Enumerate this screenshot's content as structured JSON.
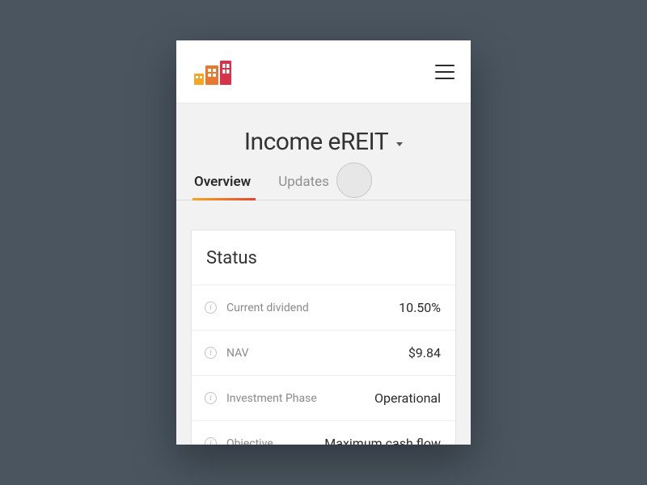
{
  "page_title": "Income eREIT",
  "tabs": {
    "overview": "Overview",
    "updates": "Updates"
  },
  "status_card": {
    "title": "Status",
    "rows": [
      {
        "label": "Current dividend",
        "value": "10.50%"
      },
      {
        "label": "NAV",
        "value": "$9.84"
      },
      {
        "label": "Investment Phase",
        "value": "Operational"
      },
      {
        "label": "Objective",
        "value": "Maximum cash flow"
      }
    ]
  }
}
